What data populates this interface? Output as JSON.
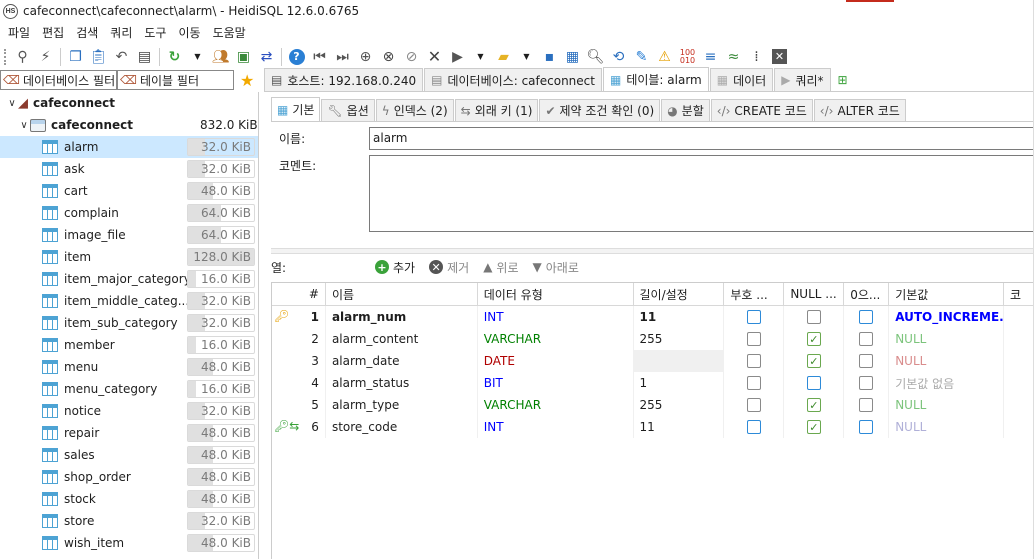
{
  "window": {
    "title": "cafeconnect\\cafeconnect\\alarm\\ - HeidiSQL 12.6.0.6765",
    "logo": "HS"
  },
  "menu": [
    "파일",
    "편집",
    "검색",
    "쿼리",
    "도구",
    "이동",
    "도움말"
  ],
  "filters": {
    "db_filter": "데이터베이스 필터",
    "table_filter": "테이블 필터"
  },
  "tabs": [
    {
      "label": "호스트: 192.168.0.240",
      "icon": "host-icon"
    },
    {
      "label": "데이터베이스: cafeconnect",
      "icon": "database-icon"
    },
    {
      "label": "테이블: alarm",
      "icon": "table-icon",
      "active": true
    },
    {
      "label": "데이터",
      "icon": "grid-icon"
    },
    {
      "label": "쿼리*",
      "icon": "play-icon"
    }
  ],
  "tree": {
    "host": "cafeconnect",
    "db": {
      "name": "cafeconnect",
      "size": "832.0 KiB"
    },
    "tables": [
      {
        "name": "alarm",
        "size": "32.0 KiB",
        "fill": 0.25,
        "selected": true
      },
      {
        "name": "ask",
        "size": "32.0 KiB",
        "fill": 0.25
      },
      {
        "name": "cart",
        "size": "48.0 KiB",
        "fill": 0.38
      },
      {
        "name": "complain",
        "size": "64.0 KiB",
        "fill": 0.5
      },
      {
        "name": "image_file",
        "size": "64.0 KiB",
        "fill": 0.5
      },
      {
        "name": "item",
        "size": "128.0 KiB",
        "fill": 1.0
      },
      {
        "name": "item_major_category",
        "size": "16.0 KiB",
        "fill": 0.12
      },
      {
        "name": "item_middle_categ...",
        "size": "32.0 KiB",
        "fill": 0.25
      },
      {
        "name": "item_sub_category",
        "size": "32.0 KiB",
        "fill": 0.25
      },
      {
        "name": "member",
        "size": "16.0 KiB",
        "fill": 0.12
      },
      {
        "name": "menu",
        "size": "48.0 KiB",
        "fill": 0.38
      },
      {
        "name": "menu_category",
        "size": "16.0 KiB",
        "fill": 0.12
      },
      {
        "name": "notice",
        "size": "32.0 KiB",
        "fill": 0.25
      },
      {
        "name": "repair",
        "size": "48.0 KiB",
        "fill": 0.38
      },
      {
        "name": "sales",
        "size": "48.0 KiB",
        "fill": 0.38
      },
      {
        "name": "shop_order",
        "size": "48.0 KiB",
        "fill": 0.38
      },
      {
        "name": "stock",
        "size": "48.0 KiB",
        "fill": 0.38
      },
      {
        "name": "store",
        "size": "32.0 KiB",
        "fill": 0.25
      },
      {
        "name": "wish_item",
        "size": "48.0 KiB",
        "fill": 0.38
      }
    ]
  },
  "subtabs": [
    {
      "label": "기본",
      "active": true
    },
    {
      "label": "옵션"
    },
    {
      "label": "인덱스 (2)"
    },
    {
      "label": "외래 키 (1)"
    },
    {
      "label": "제약 조건 확인 (0)"
    },
    {
      "label": "분할"
    },
    {
      "label": "CREATE 코드"
    },
    {
      "label": "ALTER 코드"
    }
  ],
  "form": {
    "name_label": "이름:",
    "name_value": "alarm",
    "comment_label": "코멘트:"
  },
  "columns_bar": {
    "label": "열:",
    "add": "추가",
    "remove": "제거",
    "up": "위로",
    "down": "아래로"
  },
  "grid": {
    "headers": [
      "#",
      "이름",
      "데이터 유형",
      "길이/설정",
      "부호 ...",
      "NULL ...",
      "0으...",
      "기본값",
      "코"
    ],
    "rows": [
      {
        "num": "1",
        "name": "alarm_num",
        "type": "INT",
        "typeColor": "#0000ff",
        "length": "11",
        "unsigned": false,
        "nullable": false,
        "zerofill": false,
        "default": "AUTO_INCREME...",
        "defaultColor": "#0000ff",
        "key": "primary"
      },
      {
        "num": "2",
        "name": "alarm_content",
        "type": "VARCHAR",
        "typeColor": "#008000",
        "length": "255",
        "unsigned": false,
        "nullable": true,
        "zerofill": false,
        "default": "NULL",
        "defaultColor": "#7cc47c"
      },
      {
        "num": "3",
        "name": "alarm_date",
        "type": "DATE",
        "typeColor": "#b00000",
        "length": "",
        "unsigned": false,
        "nullable": true,
        "zerofill": false,
        "default": "NULL",
        "defaultColor": "#d98c8c"
      },
      {
        "num": "4",
        "name": "alarm_status",
        "type": "BIT",
        "typeColor": "#0000ff",
        "length": "1",
        "unsigned": false,
        "nullable": false,
        "zerofill": false,
        "default": "기본값 없음",
        "defaultColor": "#aaaaaa"
      },
      {
        "num": "5",
        "name": "alarm_type",
        "type": "VARCHAR",
        "typeColor": "#008000",
        "length": "255",
        "unsigned": false,
        "nullable": true,
        "zerofill": false,
        "default": "NULL",
        "defaultColor": "#7cc47c"
      },
      {
        "num": "6",
        "name": "store_code",
        "type": "INT",
        "typeColor": "#0000ff",
        "length": "11",
        "unsigned": false,
        "nullable": true,
        "zerofill": false,
        "default": "NULL",
        "defaultColor": "#b0b0d8",
        "key": "foreign"
      }
    ]
  }
}
